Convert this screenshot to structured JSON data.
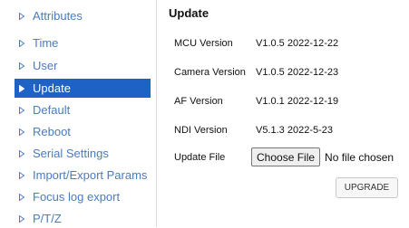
{
  "sidebar": {
    "items": [
      {
        "label": "Attributes"
      },
      {
        "label": "Time"
      },
      {
        "label": "User"
      },
      {
        "label": "Update"
      },
      {
        "label": "Default"
      },
      {
        "label": "Reboot"
      },
      {
        "label": "Serial Settings"
      },
      {
        "label": "Import/Export Params"
      },
      {
        "label": "Focus log export"
      },
      {
        "label": "P/T/Z"
      }
    ],
    "active": "Update",
    "colors": {
      "link": "#4a7bc0",
      "active_bg": "#1e62c6",
      "active_text": "#ffffff"
    },
    "icon": "triangle-right-icon"
  },
  "main": {
    "title": "Update",
    "rows": [
      {
        "label": "MCU Version",
        "value": "V1.0.5 2022-12-22"
      },
      {
        "label": "Camera Version",
        "value": "V1.0.5 2022-12-23"
      },
      {
        "label": "AF Version",
        "value": "V1.0.1 2022-12-19"
      },
      {
        "label": "NDI Version",
        "value": "V5.1.3 2022-5-23"
      }
    ],
    "file": {
      "label": "Update File",
      "button": "Choose File",
      "status": "No file chosen"
    },
    "upgrade_button": "UPGRADE"
  }
}
